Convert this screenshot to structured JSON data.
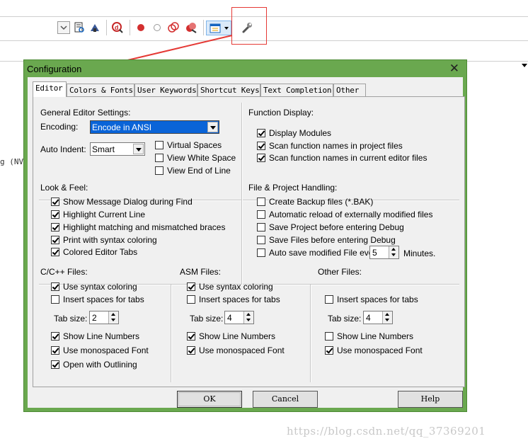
{
  "toolbar": {
    "icons": [
      "dropdown-toggle-icon",
      "find-in-files-icon",
      "source-browser-icon",
      "debug-session-icon",
      "breakpoint-insert-icon",
      "breakpoint-enable-icon",
      "breakpoints-disable-all-icon",
      "breakpoints-kill-all-icon",
      "window-layout-icon",
      "configuration-wrench-icon"
    ]
  },
  "background_text": "g (NVI",
  "annotation": {
    "color": "#e53935"
  },
  "dialog": {
    "title": "Configuration",
    "close_glyph": "✕",
    "tabs": [
      "Editor",
      "Colors & Fonts",
      "User Keywords",
      "Shortcut Keys",
      "Text Completion",
      "Other"
    ],
    "active_tab": "Editor",
    "general": {
      "heading": "General Editor Settings:",
      "encoding_label": "Encoding:",
      "encoding_value": "Encode in ANSI",
      "indent_label": "Auto Indent:",
      "indent_value": "Smart",
      "virtual_spaces": "Virtual Spaces",
      "view_white_space": "View White Space",
      "view_end_of_line": "View End of Line"
    },
    "function_display": {
      "heading": "Function Display:",
      "display_modules": "Display Modules",
      "scan_project": "Scan function names in project files",
      "scan_current": "Scan function names in current editor files"
    },
    "look_feel": {
      "heading": "Look & Feel:",
      "items": [
        "Show Message Dialog during Find",
        "Highlight Current Line",
        "Highlight matching and mismatched braces",
        "Print with syntax coloring",
        "Colored Editor Tabs"
      ]
    },
    "file_project": {
      "heading": "File & Project Handling:",
      "items": [
        "Create Backup files (*.BAK)",
        "Automatic reload of externally modified files",
        "Save Project before entering Debug",
        "Save Files before entering Debug",
        "Auto save modified File every"
      ],
      "autosave_value": "5",
      "minutes_label": "Minutes."
    },
    "c_files": {
      "heading": "C/C++ Files:",
      "use_syntax": "Use syntax coloring",
      "insert_spaces": "Insert spaces for tabs",
      "tab_size_label": "Tab size:",
      "tab_size": "2",
      "show_line_numbers": "Show Line Numbers",
      "monospaced": "Use monospaced Font",
      "outlining": "Open with Outlining"
    },
    "asm_files": {
      "heading": "ASM Files:",
      "use_syntax": "Use syntax coloring",
      "insert_spaces": "Insert spaces for tabs",
      "tab_size_label": "Tab size:",
      "tab_size": "4",
      "show_line_numbers": "Show Line Numbers",
      "monospaced": "Use monospaced Font"
    },
    "other_files": {
      "heading": "Other Files:",
      "insert_spaces": "Insert spaces for tabs",
      "tab_size_label": "Tab size:",
      "tab_size": "4",
      "show_line_numbers": "Show Line Numbers",
      "monospaced": "Use monospaced Font"
    },
    "buttons": {
      "ok": "OK",
      "cancel": "Cancel",
      "help": "Help"
    }
  },
  "watermark": "https://blog.csdn.net/qq_37369201"
}
